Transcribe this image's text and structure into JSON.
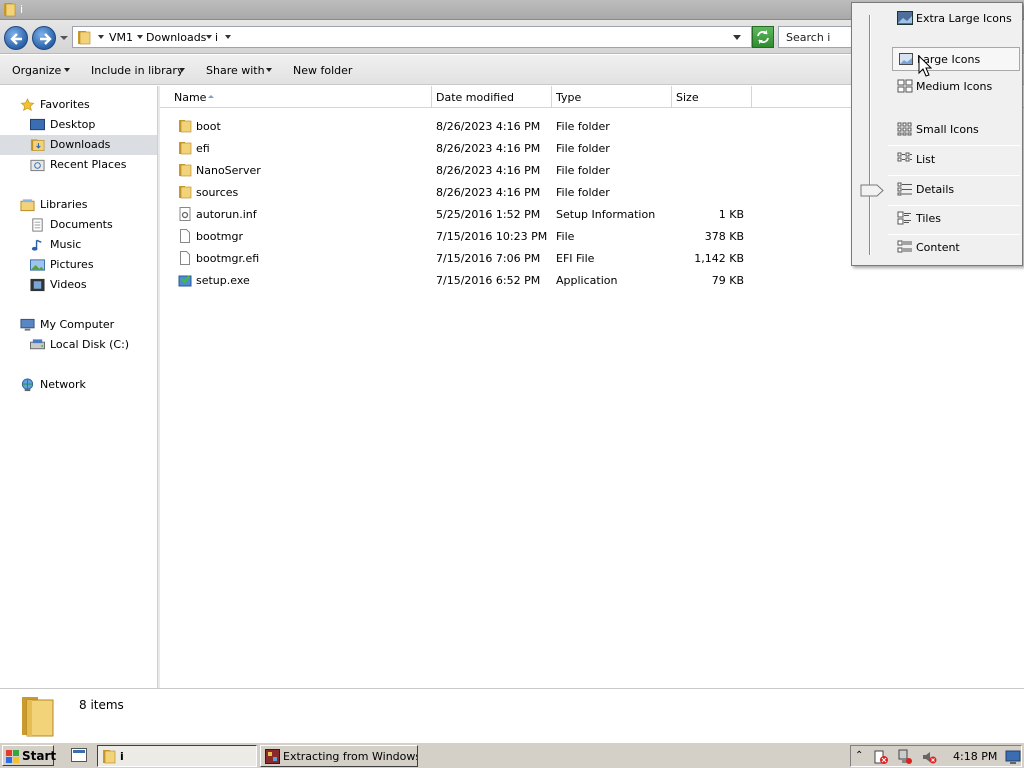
{
  "window": {
    "title": "i"
  },
  "addressbar": {
    "breadcrumbs": [
      "VM1",
      "Downloads",
      "i"
    ],
    "search_placeholder": "Search i"
  },
  "commandbar": {
    "organize": "Organize",
    "include_in_library": "Include in library",
    "share_with": "Share with",
    "new_folder": "New folder"
  },
  "navpane": {
    "favorites": {
      "label": "Favorites",
      "items": [
        "Desktop",
        "Downloads",
        "Recent Places"
      ]
    },
    "libraries": {
      "label": "Libraries",
      "items": [
        "Documents",
        "Music",
        "Pictures",
        "Videos"
      ]
    },
    "computer": {
      "label": "My Computer",
      "items": [
        "Local Disk (C:)"
      ]
    },
    "network": {
      "label": "Network"
    },
    "selected": "Downloads"
  },
  "filelist": {
    "columns": [
      "Name",
      "Date modified",
      "Type",
      "Size"
    ],
    "rows": [
      {
        "name": "boot",
        "date": "8/26/2023 4:16 PM",
        "type": "File folder",
        "size": "",
        "icon": "folder-icon"
      },
      {
        "name": "efi",
        "date": "8/26/2023 4:16 PM",
        "type": "File folder",
        "size": "",
        "icon": "folder-icon"
      },
      {
        "name": "NanoServer",
        "date": "8/26/2023 4:16 PM",
        "type": "File folder",
        "size": "",
        "icon": "folder-icon"
      },
      {
        "name": "sources",
        "date": "8/26/2023 4:16 PM",
        "type": "File folder",
        "size": "",
        "icon": "folder-icon"
      },
      {
        "name": "autorun.inf",
        "date": "5/25/2016 1:52 PM",
        "type": "Setup Information",
        "size": "1 KB",
        "icon": "settings-file-icon"
      },
      {
        "name": "bootmgr",
        "date": "7/15/2016 10:23 PM",
        "type": "File",
        "size": "378 KB",
        "icon": "file-icon"
      },
      {
        "name": "bootmgr.efi",
        "date": "7/15/2016 7:06 PM",
        "type": "EFI File",
        "size": "1,142 KB",
        "icon": "file-icon"
      },
      {
        "name": "setup.exe",
        "date": "7/15/2016 6:52 PM",
        "type": "Application",
        "size": "79 KB",
        "icon": "setup-app-icon"
      }
    ]
  },
  "details": {
    "item_count": "8 items"
  },
  "view_menu": {
    "items": [
      "Extra Large Icons",
      "Large Icons",
      "Medium Icons",
      "Small Icons",
      "List",
      "Details",
      "Tiles",
      "Content"
    ],
    "hovered": "Large Icons",
    "current": "Details"
  },
  "taskbar": {
    "start": "Start",
    "tasks": [
      "i",
      "Extracting from Windows..."
    ],
    "clock": "4:18 PM"
  },
  "colors": {
    "folder": "#e8c15a",
    "nav_selected": "#dadde2",
    "taskbar": "#d4d0c8"
  }
}
